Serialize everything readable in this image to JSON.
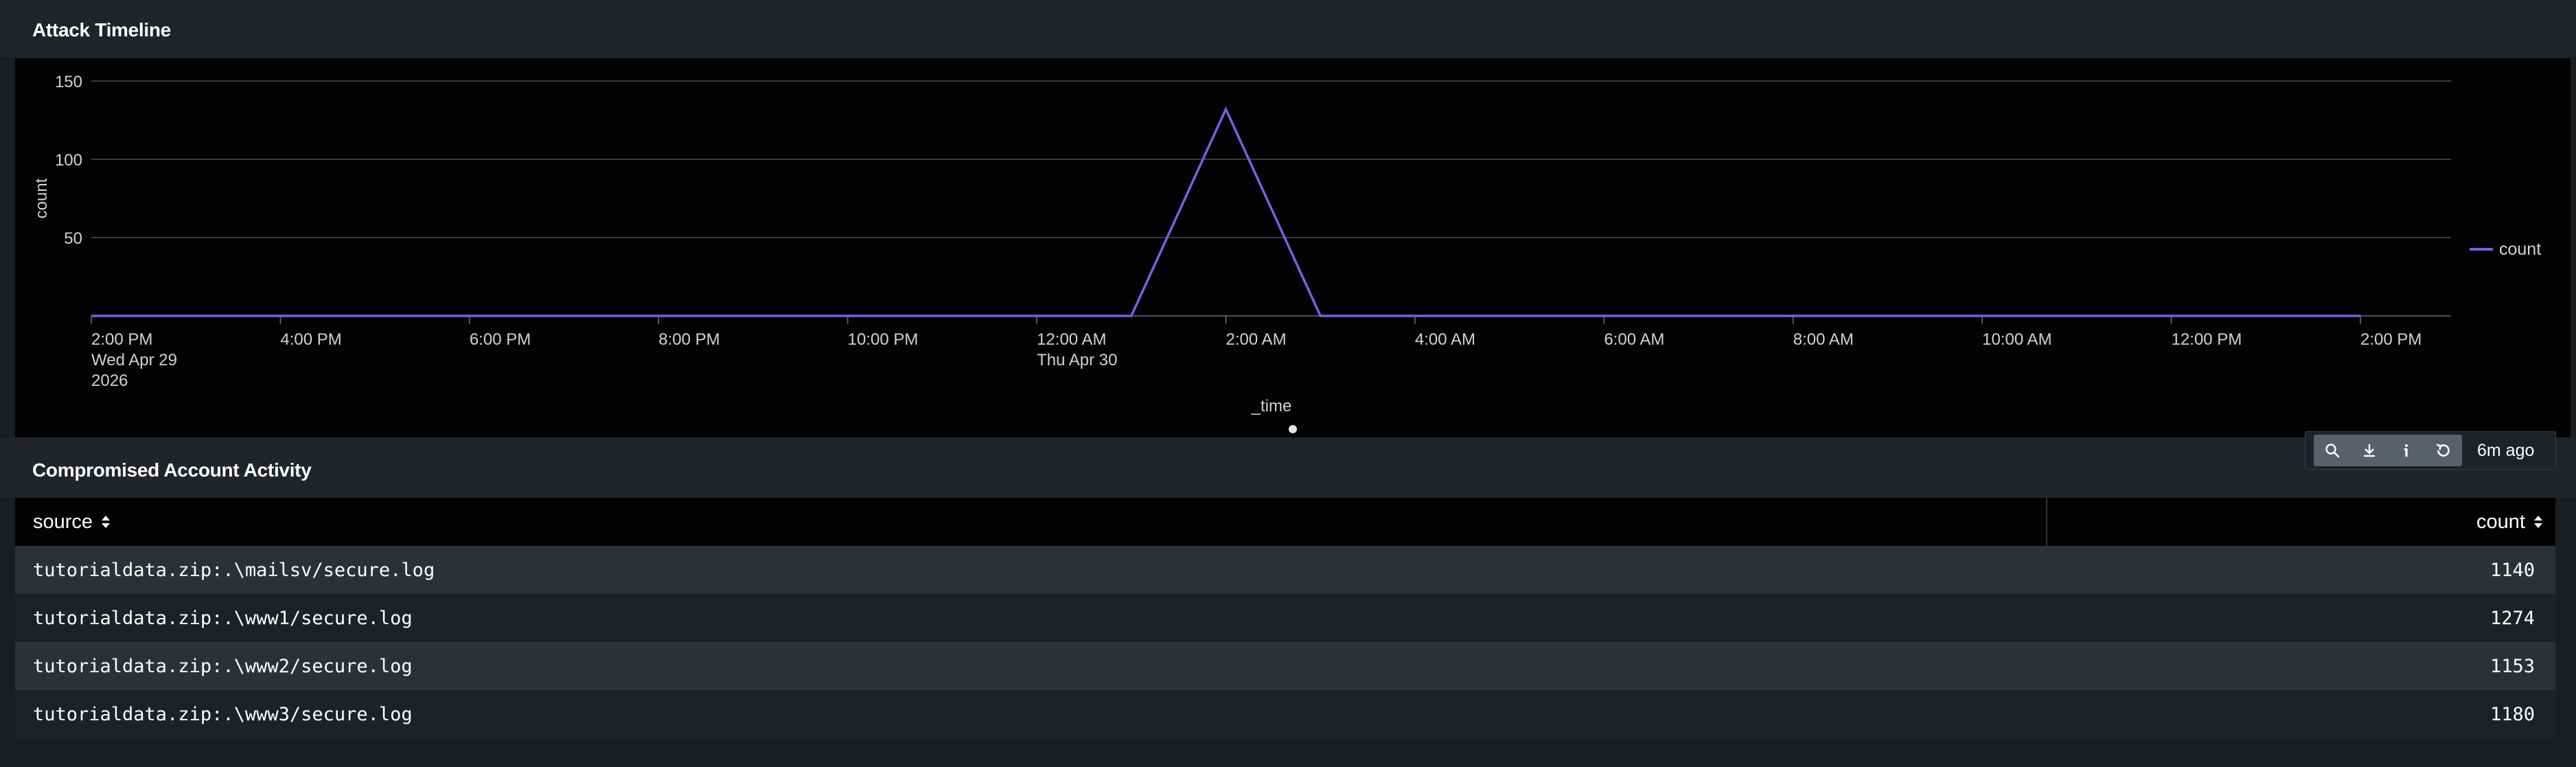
{
  "attack_timeline": {
    "title": "Attack Timeline",
    "x_axis_title": "_time",
    "y_axis_title": "count",
    "legend_label": "count",
    "series_color": "#7b5fe3",
    "x_ticks": [
      {
        "line1": "2:00 PM",
        "line2": "Wed Apr 29",
        "line3": "2026"
      },
      {
        "line1": "4:00 PM",
        "line2": "",
        "line3": ""
      },
      {
        "line1": "6:00 PM",
        "line2": "",
        "line3": ""
      },
      {
        "line1": "8:00 PM",
        "line2": "",
        "line3": ""
      },
      {
        "line1": "10:00 PM",
        "line2": "",
        "line3": ""
      },
      {
        "line1": "12:00 AM",
        "line2": "Thu Apr 30",
        "line3": ""
      },
      {
        "line1": "2:00 AM",
        "line2": "",
        "line3": ""
      },
      {
        "line1": "4:00 AM",
        "line2": "",
        "line3": ""
      },
      {
        "line1": "6:00 AM",
        "line2": "",
        "line3": ""
      },
      {
        "line1": "8:00 AM",
        "line2": "",
        "line3": ""
      },
      {
        "line1": "10:00 AM",
        "line2": "",
        "line3": ""
      },
      {
        "line1": "12:00 PM",
        "line2": "",
        "line3": ""
      },
      {
        "line1": "2:00 PM",
        "line2": "",
        "line3": ""
      }
    ],
    "y_ticks": [
      "150",
      "100",
      "50"
    ]
  },
  "chart_data": {
    "type": "line",
    "title": "Attack Timeline",
    "xlabel": "_time",
    "ylabel": "count",
    "x": [
      "2026-04-29 14:00",
      "2026-04-30 01:00",
      "2026-04-30 02:00",
      "2026-04-30 03:00",
      "2026-04-30 14:00"
    ],
    "series": [
      {
        "name": "count",
        "values": [
          0,
          0,
          132,
          0,
          0
        ]
      }
    ],
    "ylim": [
      0,
      150
    ],
    "grid": true,
    "legend": "right"
  },
  "toolbar": {
    "icons": [
      "search-icon",
      "download-icon",
      "info-icon",
      "refresh-icon"
    ],
    "last_updated": "6m ago"
  },
  "compromised": {
    "title": "Compromised Account Activity",
    "columns": [
      "source",
      "count"
    ],
    "rows": [
      {
        "source": "tutorialdata.zip:.\\mailsv/secure.log",
        "count": "1140"
      },
      {
        "source": "tutorialdata.zip:.\\www1/secure.log",
        "count": "1274"
      },
      {
        "source": "tutorialdata.zip:.\\www2/secure.log",
        "count": "1153"
      },
      {
        "source": "tutorialdata.zip:.\\www3/secure.log",
        "count": "1180"
      }
    ]
  }
}
